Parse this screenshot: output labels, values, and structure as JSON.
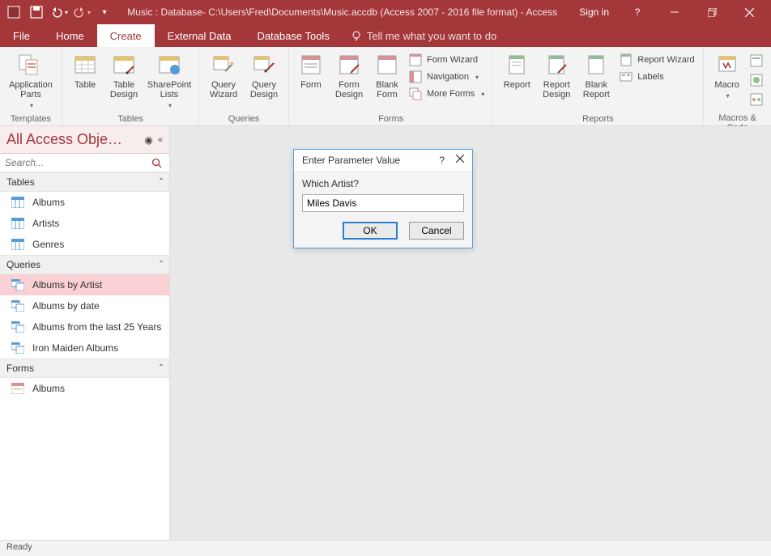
{
  "titlebar": {
    "title": "Music : Database- C:\\Users\\Fred\\Documents\\Music.accdb (Access 2007 - 2016 file format) - Access",
    "signin": "Sign in"
  },
  "tabs": {
    "file": "File",
    "home": "Home",
    "create": "Create",
    "external": "External Data",
    "dbtools": "Database Tools",
    "tellme": "Tell me what you want to do"
  },
  "ribbon": {
    "templates": {
      "label": "Templates",
      "appparts": "Application\nParts"
    },
    "tables": {
      "label": "Tables",
      "table": "Table",
      "tabledesign": "Table\nDesign",
      "splists": "SharePoint\nLists"
    },
    "queries": {
      "label": "Queries",
      "qwizard": "Query\nWizard",
      "qdesign": "Query\nDesign"
    },
    "forms": {
      "label": "Forms",
      "form": "Form",
      "formdesign": "Form\nDesign",
      "blankform": "Blank\nForm",
      "fwizard": "Form Wizard",
      "nav": "Navigation",
      "more": "More Forms"
    },
    "reports": {
      "label": "Reports",
      "report": "Report",
      "rdesign": "Report\nDesign",
      "blank": "Blank\nReport",
      "rwizard": "Report Wizard",
      "labels": "Labels"
    },
    "macros": {
      "label": "Macros & Code",
      "macro": "Macro"
    }
  },
  "nav": {
    "header": "All Access Obje…",
    "search_placeholder": "Search...",
    "cat_tables": "Tables",
    "cat_queries": "Queries",
    "cat_forms": "Forms",
    "tables": [
      "Albums",
      "Artists",
      "Genres"
    ],
    "queries": [
      "Albums by Artist",
      "Albums by date",
      "Albums from the last 25 Years",
      "Iron Maiden Albums"
    ],
    "forms": [
      "Albums"
    ]
  },
  "dialog": {
    "title": "Enter Parameter Value",
    "prompt": "Which Artist?",
    "value": "Miles Davis",
    "ok": "OK",
    "cancel": "Cancel"
  },
  "status": {
    "ready": "Ready"
  }
}
